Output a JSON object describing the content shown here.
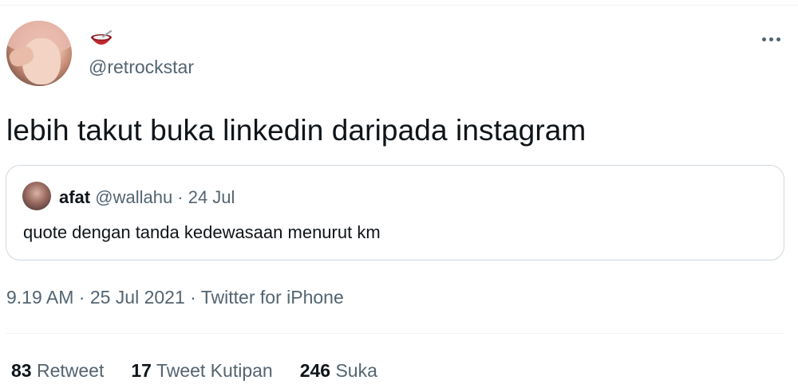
{
  "tweet": {
    "handle": "@retrockstar",
    "text": "lebih takut buka linkedin daripada instagram",
    "timestamp": "9.19 AM · 25 Jul 2021 · Twitter for iPhone"
  },
  "quote": {
    "name": "afat",
    "handle_date": " @wallahu · 24 Jul",
    "text": "quote dengan tanda kedewasaan menurut km"
  },
  "stats": [
    {
      "count": "83",
      "label": " Retweet"
    },
    {
      "count": "17",
      "label": " Tweet Kutipan"
    },
    {
      "count": "246",
      "label": " Suka"
    }
  ],
  "icons": {
    "display_name_emoji": "bowl-with-spoon-icon",
    "more": "more-horizontal-icon"
  },
  "colors": {
    "text": "#0f1419",
    "secondary": "#536471",
    "border": "#cfd9de"
  }
}
